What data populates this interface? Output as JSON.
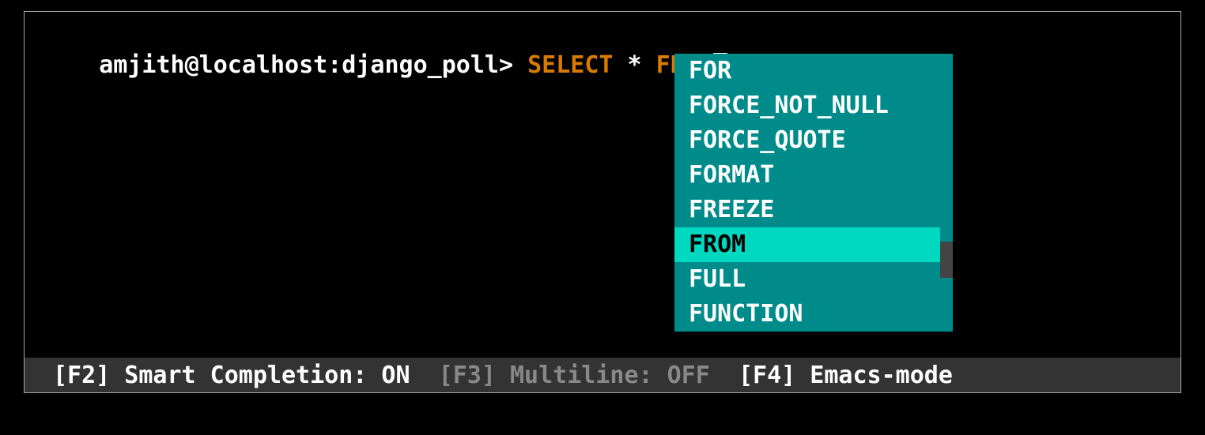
{
  "prompt": {
    "user_host_db": "amjith@localhost:django_poll> ",
    "sql_select": "SELECT",
    "sql_star": " * ",
    "sql_from": "FROM"
  },
  "completion": {
    "items": [
      {
        "label": "FOR",
        "selected": false
      },
      {
        "label": "FORCE_NOT_NULL",
        "selected": false
      },
      {
        "label": "FORCE_QUOTE",
        "selected": false
      },
      {
        "label": "FORMAT",
        "selected": false
      },
      {
        "label": "FREEZE",
        "selected": false
      },
      {
        "label": "FROM",
        "selected": true
      },
      {
        "label": "FULL",
        "selected": false
      },
      {
        "label": "FUNCTION",
        "selected": false
      }
    ]
  },
  "statusbar": {
    "f2_key": "[F2]",
    "f2_label": " Smart Completion: ON  ",
    "f3_key": "[F3]",
    "f3_label": " Multiline: OFF  ",
    "f4_key": "[F4]",
    "f4_label": " Emacs-mode"
  }
}
